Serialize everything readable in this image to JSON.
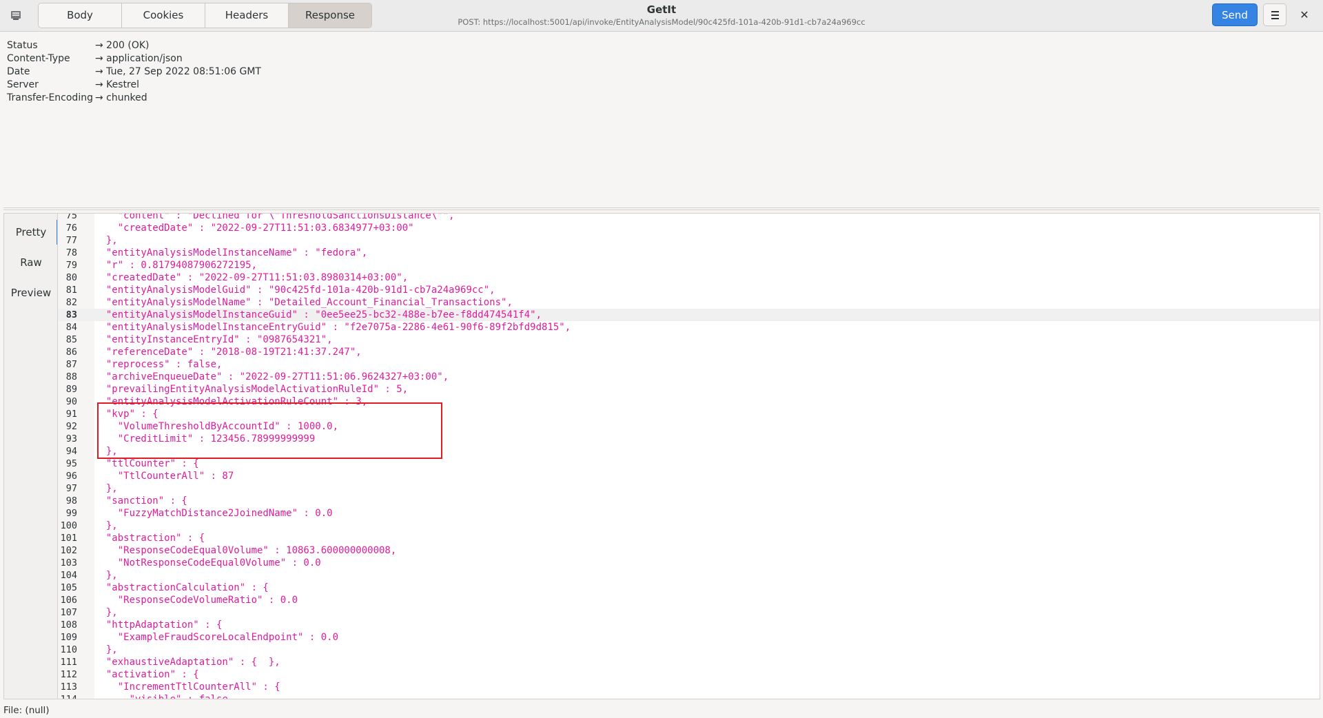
{
  "header": {
    "tabs": [
      {
        "label": "Body",
        "active": false
      },
      {
        "label": "Cookies",
        "active": false
      },
      {
        "label": "Headers",
        "active": false
      },
      {
        "label": "Response",
        "active": true
      }
    ],
    "title": "GetIt",
    "subtitle": "POST: https://localhost:5001/api/invoke/EntityAnalysisModel/90c425fd-101a-420b-91d1-cb7a24a969cc",
    "send_label": "Send",
    "icons": {
      "app": "app-icon",
      "menu": "hamburger-menu-icon",
      "close": "close-icon"
    },
    "accent_color": "#3584e4"
  },
  "response_headers": [
    {
      "name": "Status",
      "value": "→ 200 (OK)"
    },
    {
      "name": "Content-Type",
      "value": "→ application/json"
    },
    {
      "name": "Date",
      "value": "→ Tue, 27 Sep 2022 08:51:06 GMT"
    },
    {
      "name": "Server",
      "value": "→ Kestrel"
    },
    {
      "name": "Transfer-Encoding",
      "value": "→ chunked"
    }
  ],
  "view_tabs": [
    {
      "label": "Pretty",
      "active": true
    },
    {
      "label": "Raw",
      "active": false
    },
    {
      "label": "Preview",
      "active": false
    }
  ],
  "code": {
    "string_color": "#e01b9c",
    "current_line": "83",
    "lines": [
      {
        "n": "75",
        "t": "    \"content\" : \"Declined for \\\"ThresholdSanctionsDistance\\\"\","
      },
      {
        "n": "76",
        "t": "    \"createdDate\" : \"2022-09-27T11:51:03.6834977+03:00\""
      },
      {
        "n": "77",
        "t": "  },"
      },
      {
        "n": "78",
        "t": "  \"entityAnalysisModelInstanceName\" : \"fedora\","
      },
      {
        "n": "79",
        "t": "  \"r\" : 0.81794087906272195,"
      },
      {
        "n": "80",
        "t": "  \"createdDate\" : \"2022-09-27T11:51:03.8980314+03:00\","
      },
      {
        "n": "81",
        "t": "  \"entityAnalysisModelGuid\" : \"90c425fd-101a-420b-91d1-cb7a24a969cc\","
      },
      {
        "n": "82",
        "t": "  \"entityAnalysisModelName\" : \"Detailed_Account_Financial_Transactions\","
      },
      {
        "n": "83",
        "t": "  \"entityAnalysisModelInstanceGuid\" : \"0ee5ee25-bc32-488e-b7ee-f8dd474541f4\","
      },
      {
        "n": "84",
        "t": "  \"entityAnalysisModelInstanceEntryGuid\" : \"f2e7075a-2286-4e61-90f6-89f2bfd9d815\","
      },
      {
        "n": "85",
        "t": "  \"entityInstanceEntryId\" : \"0987654321\","
      },
      {
        "n": "86",
        "t": "  \"referenceDate\" : \"2018-08-19T21:41:37.247\","
      },
      {
        "n": "87",
        "t": "  \"reprocess\" : false,"
      },
      {
        "n": "88",
        "t": "  \"archiveEnqueueDate\" : \"2022-09-27T11:51:06.9624327+03:00\","
      },
      {
        "n": "89",
        "t": "  \"prevailingEntityAnalysisModelActivationRuleId\" : 5,"
      },
      {
        "n": "90",
        "t": "  \"entityAnalysisModelActivationRuleCount\" : 3,"
      },
      {
        "n": "91",
        "t": "  \"kvp\" : {"
      },
      {
        "n": "92",
        "t": "    \"VolumeThresholdByAccountId\" : 1000.0,"
      },
      {
        "n": "93",
        "t": "    \"CreditLimit\" : 123456.78999999999"
      },
      {
        "n": "94",
        "t": "  },"
      },
      {
        "n": "95",
        "t": "  \"ttlCounter\" : {"
      },
      {
        "n": "96",
        "t": "    \"TtlCounterAll\" : 87"
      },
      {
        "n": "97",
        "t": "  },"
      },
      {
        "n": "98",
        "t": "  \"sanction\" : {"
      },
      {
        "n": "99",
        "t": "    \"FuzzyMatchDistance2JoinedName\" : 0.0"
      },
      {
        "n": "100",
        "t": "  },"
      },
      {
        "n": "101",
        "t": "  \"abstraction\" : {"
      },
      {
        "n": "102",
        "t": "    \"ResponseCodeEqual0Volume\" : 10863.600000000008,"
      },
      {
        "n": "103",
        "t": "    \"NotResponseCodeEqual0Volume\" : 0.0"
      },
      {
        "n": "104",
        "t": "  },"
      },
      {
        "n": "105",
        "t": "  \"abstractionCalculation\" : {"
      },
      {
        "n": "106",
        "t": "    \"ResponseCodeVolumeRatio\" : 0.0"
      },
      {
        "n": "107",
        "t": "  },"
      },
      {
        "n": "108",
        "t": "  \"httpAdaptation\" : {"
      },
      {
        "n": "109",
        "t": "    \"ExampleFraudScoreLocalEndpoint\" : 0.0"
      },
      {
        "n": "110",
        "t": "  },"
      },
      {
        "n": "111",
        "t": "  \"exhaustiveAdaptation\" : {  },"
      },
      {
        "n": "112",
        "t": "  \"activation\" : {"
      },
      {
        "n": "113",
        "t": "    \"IncrementTtlCounterAll\" : {"
      },
      {
        "n": "114",
        "t": "      \"visible\" : false,"
      }
    ]
  },
  "status_bar": "File: (null)"
}
